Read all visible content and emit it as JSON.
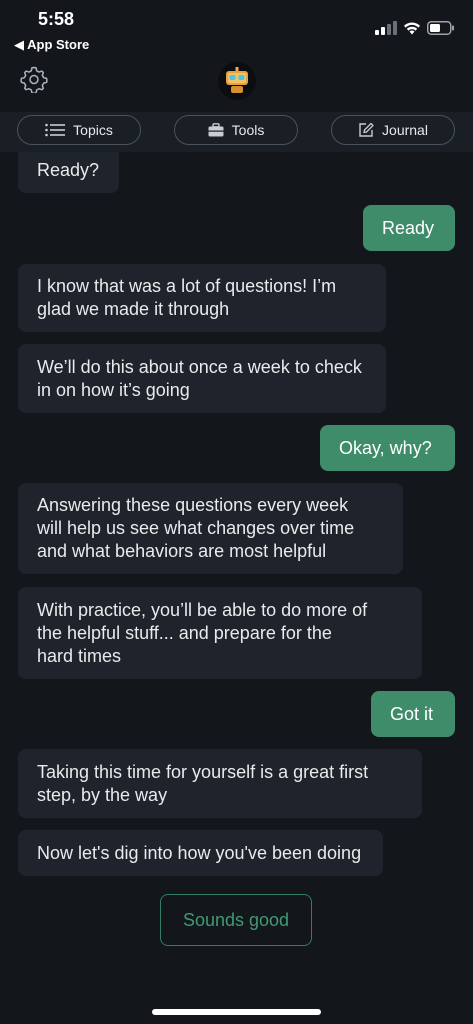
{
  "status_bar": {
    "time": "5:58",
    "back_label": "◀ App Store"
  },
  "header": {
    "settings_icon": "gear-icon",
    "logo_icon": "robot-logo-icon"
  },
  "nav": {
    "topics": "Topics",
    "tools": "Tools",
    "journal": "Journal"
  },
  "messages": [
    {
      "from": "bot",
      "text": "Ready?"
    },
    {
      "from": "user",
      "text": "Ready"
    },
    {
      "from": "bot",
      "text": "I know that was a lot of questions! I’m\nglad we made it through"
    },
    {
      "from": "bot",
      "text": "We’ll do this about once a week to check\nin on how it’s going"
    },
    {
      "from": "user",
      "text": "Okay, why?"
    },
    {
      "from": "bot",
      "text": "Answering these questions every week\nwill help us see what changes over time\nand what behaviors are most helpful"
    },
    {
      "from": "bot",
      "text": "With practice, you’ll be able to do more of\nthe helpful stuff... and prepare for the\nhard times"
    },
    {
      "from": "user",
      "text": "Got it"
    },
    {
      "from": "bot",
      "text": "Taking this time for yourself is a great first\nstep, by the way"
    },
    {
      "from": "bot",
      "text": "Now let's dig into how you've been doing"
    }
  ],
  "reply": {
    "label": "Sounds good"
  },
  "colors": {
    "background": "#13171c",
    "bot_bubble": "#1f242c",
    "user_bubble": "#3f8c6b",
    "accent": "#3f9a73"
  }
}
